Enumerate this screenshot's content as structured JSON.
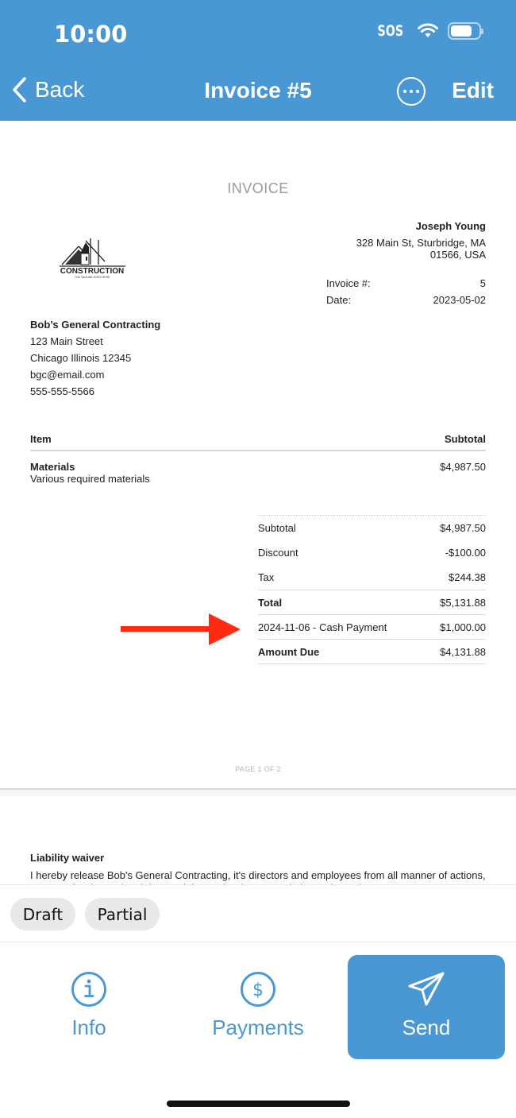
{
  "status_bar": {
    "time": "10:00",
    "carrier": "SOS",
    "battery_level": 0.75
  },
  "nav": {
    "back_label": "Back",
    "title": "Invoice #5",
    "edit_label": "Edit"
  },
  "colors": {
    "brand": "#4a98d3",
    "annotation_arrow": "#ff2a10",
    "tag_bg": "#e8e9eb"
  },
  "document": {
    "heading": "INVOICE",
    "logo": {
      "text": "CONSTRUCTION",
      "tagline": "YOU TAGLINE GOES HERE"
    },
    "client": {
      "name": "Joseph Young",
      "address_line1": "328 Main St, Sturbridge, MA",
      "address_line2": "01566, USA"
    },
    "meta": [
      {
        "label": "Invoice #:",
        "value": "5"
      },
      {
        "label": "Date:",
        "value": "2023-05-02"
      }
    ],
    "company": {
      "name": "Bob’s General Contracting",
      "street": "123 Main Street",
      "city": "Chicago Illinois 12345",
      "email": "bgc@email.com",
      "phone": "555-555-5566"
    },
    "items_header": {
      "item": "Item",
      "subtotal": "Subtotal"
    },
    "items": [
      {
        "name": "Materials",
        "description": "Various required materials",
        "subtotal": "$4,987.50"
      }
    ],
    "totals": [
      {
        "label": "Subtotal",
        "value": "$4,987.50"
      },
      {
        "label": "Discount",
        "value": "-$100.00"
      },
      {
        "label": "Tax",
        "value": "$244.38"
      },
      {
        "label": "Total",
        "value": "$5,131.88"
      },
      {
        "label": "2024-11-06 - Cash Payment",
        "value": "$1,000.00"
      },
      {
        "label": "Amount Due",
        "value": "$4,131.88"
      }
    ],
    "page_indicator": "PAGE 1 OF 2",
    "waiver": {
      "title": "Liability waiver",
      "text": "I hereby release Bob's General Contracting, it's directors and employees from all manner of actions, causes of action, suits, debts, and demands whatsoever in law or in equity"
    }
  },
  "tags": [
    "Draft",
    "Partial"
  ],
  "actions": [
    {
      "label": "Info",
      "icon": "info-icon"
    },
    {
      "label": "Payments",
      "icon": "dollar-icon"
    },
    {
      "label": "Send",
      "icon": "send-icon"
    }
  ]
}
